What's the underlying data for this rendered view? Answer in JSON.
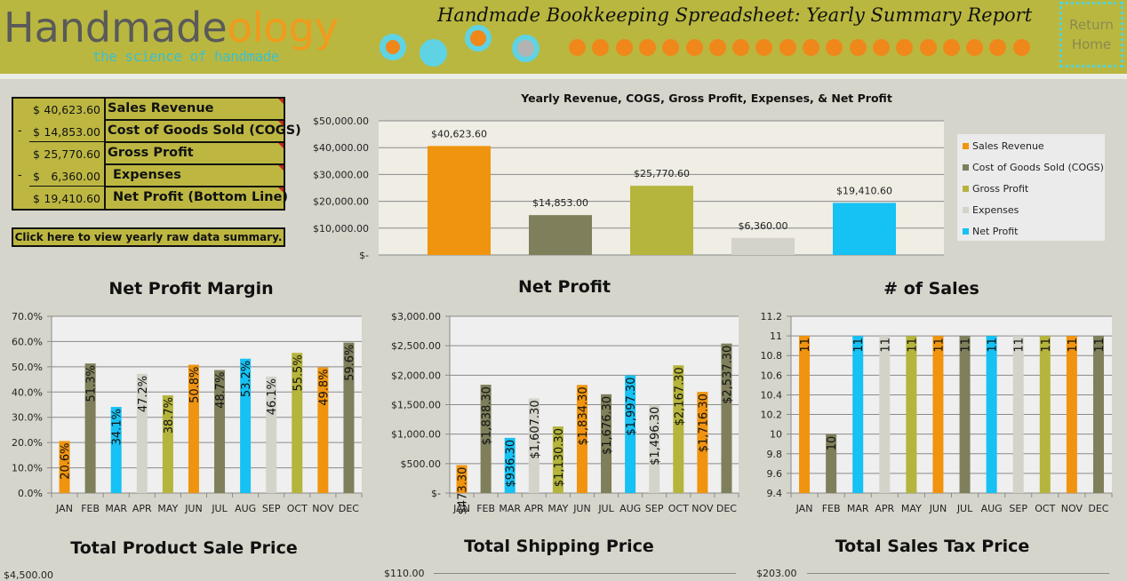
{
  "header": {
    "logo_main": "Handmade",
    "logo_suffix": "ology",
    "tagline": "the science of handmade",
    "report_title": "Handmade Bookkeeping Spreadsheet:  Yearly Summary Report",
    "return_home_line1": "Return",
    "return_home_line2": "Home"
  },
  "colors": {
    "header_bg": "#b9b73f",
    "sales_revenue": "#f0940f",
    "cogs": "#7f7f5c",
    "gross_profit": "#b5b43c",
    "expenses": "#d4d3ca",
    "net_profit": "#16c1f3",
    "accent_dot": "#f0871b",
    "accent_cyan": "#5fd3e3"
  },
  "summary": {
    "rows": [
      {
        "sign": "",
        "currency": "$",
        "amount": "40,623.60",
        "label": "Sales Revenue"
      },
      {
        "sign": "-",
        "currency": "$",
        "amount": "14,853.00",
        "label": "Cost of Goods Sold (COGS)"
      },
      {
        "sign": "",
        "currency": "$",
        "amount": "25,770.60",
        "label": "Gross Profit"
      },
      {
        "sign": "-",
        "currency": "$",
        "amount": "6,360.00",
        "label": "Expenses"
      },
      {
        "sign": "",
        "currency": "$",
        "amount": "19,410.60",
        "label": "Net Profit (Bottom Line)"
      }
    ],
    "raw_data_button": "Click here to view yearly raw data summary."
  },
  "chart_data": [
    {
      "id": "yearly",
      "type": "bar",
      "title": "Yearly Revenue, COGS, Gross Profit, Expenses, & Net Profit",
      "categories": [
        "Sales Revenue",
        "Cost of Goods Sold (COGS)",
        "Gross Profit",
        "Expenses",
        "Net Profit"
      ],
      "values": [
        40623.6,
        14853.0,
        25770.6,
        6360.0,
        19410.6
      ],
      "data_labels": [
        "$40,623.60",
        "$14,853.00",
        "$25,770.60",
        "$6,360.00",
        "$19,410.60"
      ],
      "colors": [
        "#f0940f",
        "#7f7f5c",
        "#b5b43c",
        "#d4d3ca",
        "#16c1f3"
      ],
      "ylim": [
        0,
        50000
      ],
      "yticks": [
        0,
        10000,
        20000,
        30000,
        40000,
        50000
      ],
      "ytick_labels": [
        "$-",
        "$10,000.00",
        "$20,000.00",
        "$30,000.00",
        "$40,000.00",
        "$50,000.00"
      ],
      "legend": [
        "Sales Revenue",
        "Cost of Goods Sold (COGS)",
        "Gross Profit",
        "Expenses",
        "Net Profit"
      ],
      "legend_position": "right",
      "grid": true
    },
    {
      "id": "margin",
      "type": "bar",
      "title": "Net Profit Margin",
      "categories": [
        "JAN",
        "FEB",
        "MAR",
        "APR",
        "MAY",
        "JUN",
        "JUL",
        "AUG",
        "SEP",
        "OCT",
        "NOV",
        "DEC"
      ],
      "values": [
        20.6,
        51.3,
        34.1,
        47.2,
        38.7,
        50.8,
        48.7,
        53.2,
        46.1,
        55.5,
        49.8,
        59.6
      ],
      "data_labels": [
        "20.6%",
        "51.3%",
        "34.1%",
        "47.2%",
        "38.7%",
        "50.8%",
        "48.7%",
        "53.2%",
        "46.1%",
        "55.5%",
        "49.8%",
        "59.6%"
      ],
      "ylim": [
        0,
        70
      ],
      "yticks": [
        0,
        10,
        20,
        30,
        40,
        50,
        60,
        70
      ],
      "ytick_labels": [
        "0.0%",
        "10.0%",
        "20.0%",
        "30.0%",
        "40.0%",
        "50.0%",
        "60.0%",
        "70.0%"
      ],
      "grid": true
    },
    {
      "id": "netprofit",
      "type": "bar",
      "title": "Net Profit",
      "categories": [
        "JAN",
        "FEB",
        "MAR",
        "APR",
        "MAY",
        "JUN",
        "JUL",
        "AUG",
        "SEP",
        "OCT",
        "NOV",
        "DEC"
      ],
      "values": [
        473.3,
        1838.3,
        936.3,
        1607.3,
        1130.3,
        1834.3,
        1676.3,
        1997.3,
        1496.3,
        2167.3,
        1716.3,
        2537.3
      ],
      "data_labels": [
        "$473.30",
        "$1,838.30",
        "$936.30",
        "$1,607.30",
        "$1,130.30",
        "$1,834.30",
        "$1,676.30",
        "$1,997.30",
        "$1,496.30",
        "$2,167.30",
        "$1,716.30",
        "$2,537.30"
      ],
      "ylim": [
        0,
        3000
      ],
      "yticks": [
        0,
        500,
        1000,
        1500,
        2000,
        2500,
        3000
      ],
      "ytick_labels": [
        "$-",
        "$500.00",
        "$1,000.00",
        "$1,500.00",
        "$2,000.00",
        "$2,500.00",
        "$3,000.00"
      ],
      "grid": true
    },
    {
      "id": "sales",
      "type": "bar",
      "title": "# of Sales",
      "categories": [
        "JAN",
        "FEB",
        "MAR",
        "APR",
        "MAY",
        "JUN",
        "JUL",
        "AUG",
        "SEP",
        "OCT",
        "NOV",
        "DEC"
      ],
      "values": [
        11,
        10,
        11,
        11,
        11,
        11,
        11,
        11,
        11,
        11,
        11,
        11
      ],
      "data_labels": [
        "11",
        "10",
        "11",
        "11",
        "11",
        "11",
        "11",
        "11",
        "11",
        "11",
        "11",
        "11"
      ],
      "ylim": [
        9.4,
        11.2
      ],
      "yticks": [
        9.4,
        9.6,
        9.8,
        10,
        10.2,
        10.4,
        10.6,
        10.8,
        11,
        11.2
      ],
      "ytick_labels": [
        "9.4",
        "9.6",
        "9.8",
        "10",
        "10.2",
        "10.4",
        "10.6",
        "10.8",
        "11",
        "11.2"
      ],
      "grid": true
    },
    {
      "id": "productsale",
      "type": "bar",
      "title": "Total Product Sale Price",
      "ytick_labels_visible": [
        "$4,500.00"
      ]
    },
    {
      "id": "shipping",
      "type": "bar",
      "title": "Total Shipping Price",
      "ytick_labels_visible": [
        "$110.00"
      ]
    },
    {
      "id": "salestax",
      "type": "bar",
      "title": "Total Sales Tax Price",
      "ytick_labels_visible": [
        "$203.00"
      ]
    }
  ],
  "monthly_colors": [
    "#f0940f",
    "#7f7f5c",
    "#16c1f3",
    "#d4d3ca",
    "#b5b43c",
    "#f0940f",
    "#7f7f5c",
    "#16c1f3",
    "#d4d3ca",
    "#b5b43c",
    "#f0940f",
    "#7f7f5c"
  ]
}
